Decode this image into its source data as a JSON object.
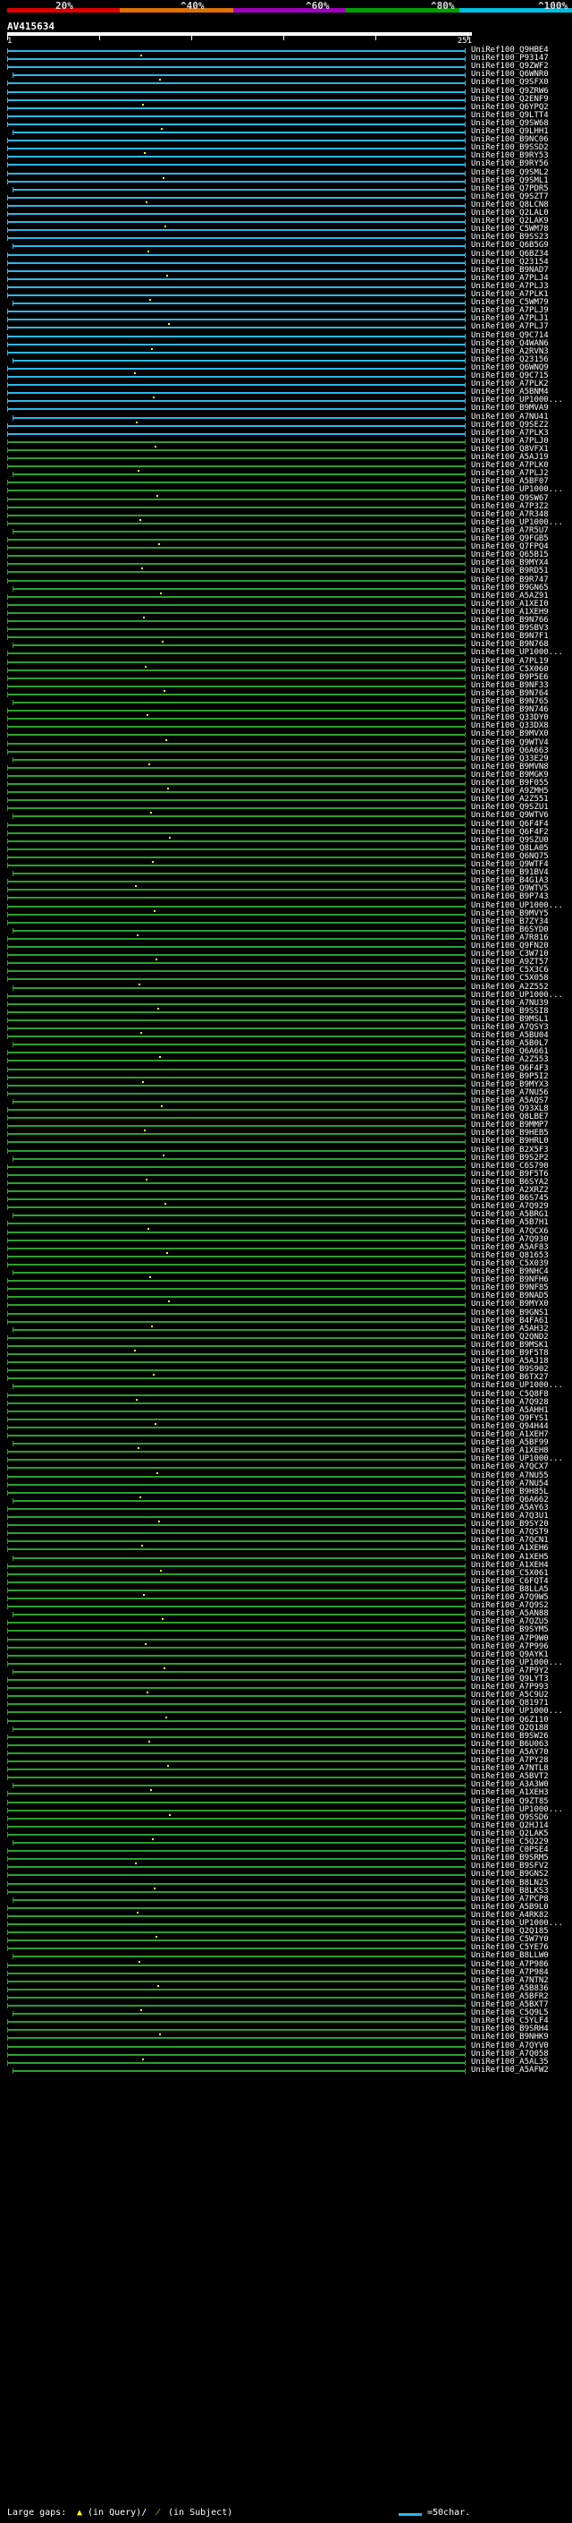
{
  "scale": {
    "labels": [
      "20%",
      "^40%",
      "^60%",
      "^80%",
      "^100%"
    ],
    "colors": [
      "#e00000",
      "#e07000",
      "#a000c0",
      "#00a000",
      "#00c0e0"
    ]
  },
  "query_id": "AV415634",
  "ruler": {
    "start": "1",
    "end": "251"
  },
  "hits": [
    {
      "id": "UniRef100_Q9HBE4",
      "c": "#2bb8e8"
    },
    {
      "id": "UniRef100_P93147",
      "c": "#2bb8e8"
    },
    {
      "id": "UniRef100_Q9ZWF2",
      "c": "#2bb8e8"
    },
    {
      "id": "UniRef100_Q6WNR0",
      "c": "#2bb8e8"
    },
    {
      "id": "UniRef100_Q9SFX0",
      "c": "#2bb8e8"
    },
    {
      "id": "UniRef100_Q9ZRW6",
      "c": "#2bb8e8"
    },
    {
      "id": "UniRef100_Q2ENF9",
      "c": "#2bb8e8"
    },
    {
      "id": "UniRef100_Q6YPQ2",
      "c": "#2bb8e8"
    },
    {
      "id": "UniRef100_Q9LTT4",
      "c": "#2bb8e8"
    },
    {
      "id": "UniRef100_Q9SW68",
      "c": "#2bb8e8"
    },
    {
      "id": "UniRef100_Q9LHH1",
      "c": "#2bb8e8"
    },
    {
      "id": "UniRef100_B9NC06",
      "c": "#2bb8e8"
    },
    {
      "id": "UniRef100_B9SSD2",
      "c": "#2bb8e8"
    },
    {
      "id": "UniRef100_B9RY53",
      "c": "#2bb8e8"
    },
    {
      "id": "UniRef100_B9RY56",
      "c": "#2bb8e8"
    },
    {
      "id": "UniRef100_Q9SML2",
      "c": "#2bb8e8"
    },
    {
      "id": "UniRef100_Q9SML1",
      "c": "#2bb8e8"
    },
    {
      "id": "UniRef100_Q7PDR5",
      "c": "#2bb8e8"
    },
    {
      "id": "UniRef100_Q9SZT7",
      "c": "#2bb8e8"
    },
    {
      "id": "UniRef100_Q8LCN8",
      "c": "#2bb8e8"
    },
    {
      "id": "UniRef100_Q2LAL0",
      "c": "#2bb8e8"
    },
    {
      "id": "UniRef100_Q2LAK9",
      "c": "#2bb8e8"
    },
    {
      "id": "UniRef100_C5WM78",
      "c": "#2bb8e8"
    },
    {
      "id": "UniRef100_B9SS23",
      "c": "#2bb8e8"
    },
    {
      "id": "UniRef100_Q6B5G9",
      "c": "#2bb8e8"
    },
    {
      "id": "UniRef100_Q6BZ34",
      "c": "#2bb8e8"
    },
    {
      "id": "UniRef100_Q23154",
      "c": "#2bb8e8"
    },
    {
      "id": "UniRef100_B9NAD7",
      "c": "#2bb8e8"
    },
    {
      "id": "UniRef100_A7PLJ4",
      "c": "#2bb8e8"
    },
    {
      "id": "UniRef100_A7PLJ3",
      "c": "#2bb8e8"
    },
    {
      "id": "UniRef100_A7PLK1",
      "c": "#2bb8e8"
    },
    {
      "id": "UniRef100_C5WM79",
      "c": "#2bb8e8"
    },
    {
      "id": "UniRef100_A7PLJ9",
      "c": "#2bb8e8"
    },
    {
      "id": "UniRef100_A7PLJ1",
      "c": "#2bb8e8"
    },
    {
      "id": "UniRef100_A7PLJ7",
      "c": "#2bb8e8"
    },
    {
      "id": "UniRef100_Q9C714",
      "c": "#2bb8e8"
    },
    {
      "id": "UniRef100_Q4WAN6",
      "c": "#2bb8e8"
    },
    {
      "id": "UniRef100_A2RVN3",
      "c": "#2bb8e8"
    },
    {
      "id": "UniRef100_Q23156",
      "c": "#2bb8e8"
    },
    {
      "id": "UniRef100_Q6WNQ9",
      "c": "#2bb8e8"
    },
    {
      "id": "UniRef100_Q9C715",
      "c": "#2bb8e8"
    },
    {
      "id": "UniRef100_A7PLK2",
      "c": "#2bb8e8"
    },
    {
      "id": "UniRef100_A5BNM4",
      "c": "#2bb8e8"
    },
    {
      "id": "UniRef100_UP1000...",
      "c": "#2bb8e8"
    },
    {
      "id": "UniRef100_B9MVA9",
      "c": "#2bb8e8"
    },
    {
      "id": "UniRef100_A7NU41",
      "c": "#2bb8e8"
    },
    {
      "id": "UniRef100_Q9SEZ2",
      "c": "#2bb8e8"
    },
    {
      "id": "UniRef100_A7PLK3",
      "c": "#2bb8e8"
    },
    {
      "id": "UniRef100_A7PLJ0",
      "c": "#2bb8e8"
    },
    {
      "id": "UniRef100_Q8VFX1",
      "c": "#2bb8e8"
    },
    {
      "id": "UniRef100_A5AJ19",
      "c": "#2bb8e8"
    },
    {
      "id": "UniRef100_A7PLK0",
      "c": "#2bb8e8"
    },
    {
      "id": "UniRef100_A7PLJ2",
      "c": "#2bb8e8"
    },
    {
      "id": "UniRef100_A5BF07",
      "c": "#2bb8e8"
    },
    {
      "id": "UniRef100_UP1000...",
      "c": "#2bb8e8"
    },
    {
      "id": "UniRef100_Q9SW67",
      "c": "#2bb8e8"
    },
    {
      "id": "UniRef100_A7P3Z2",
      "c": "#2bb8e8"
    },
    {
      "id": "UniRef100_A7R348",
      "c": "#2bb8e8"
    },
    {
      "id": "UniRef100_UP1000...",
      "c": "#2bb8e8"
    },
    {
      "id": "UniRef100_A7R5U7",
      "c": "#2bb8e8"
    },
    {
      "id": "UniRef100_Q9FGB5",
      "c": "#2bb8e8"
    },
    {
      "id": "UniRef100_Q7FPQ4",
      "c": "#2bb8e8"
    },
    {
      "id": "UniRef100_Q65B15",
      "c": "#2bb8e8"
    },
    {
      "id": "UniRef100_B9MYX4",
      "c": "#2bb8e8"
    },
    {
      "id": "UniRef100_B9RD51",
      "c": "#2bb8e8"
    },
    {
      "id": "UniRef100_B9R747",
      "c": "#2bb8e8"
    },
    {
      "id": "UniRef100_B9GN65",
      "c": "#2bb8e8"
    },
    {
      "id": "UniRef100_A5AZ91",
      "c": "#2bb8e8"
    },
    {
      "id": "UniRef100_A1XEI0",
      "c": "#2bb8e8"
    },
    {
      "id": "UniRef100_A1XEH9",
      "c": "#2bb8e8"
    },
    {
      "id": "UniRef100_B9N766",
      "c": "#2bb8e8"
    },
    {
      "id": "UniRef100_B9SBV3",
      "c": "#2bb8e8"
    },
    {
      "id": "UniRef100_B9N7F1",
      "c": "#2bb8e8"
    },
    {
      "id": "UniRef100_B9N768",
      "c": "#2bb8e8"
    },
    {
      "id": "UniRef100_UP1000...",
      "c": "#2bb8e8"
    },
    {
      "id": "UniRef100_A7PL19",
      "c": "#2bb8e8"
    },
    {
      "id": "UniRef100_C5X060",
      "c": "#2bb8e8"
    },
    {
      "id": "UniRef100_B9P5E6",
      "c": "#2bb8e8"
    },
    {
      "id": "UniRef100_B9NF33",
      "c": "#2bb8e8"
    },
    {
      "id": "UniRef100_B9N764",
      "c": "#2bb8e8"
    },
    {
      "id": "UniRef100_B9N765",
      "c": "#2bb8e8"
    },
    {
      "id": "UniRef100_B9N746",
      "c": "#2bb8e8"
    },
    {
      "id": "UniRef100_Q33DY0",
      "c": "#2bb8e8"
    },
    {
      "id": "UniRef100_Q33DX8",
      "c": "#2bb8e8"
    },
    {
      "id": "UniRef100_B9MVX0",
      "c": "#2bb8e8"
    },
    {
      "id": "UniRef100_Q9WTV4",
      "c": "#2bb8e8"
    },
    {
      "id": "UniRef100_Q6A663",
      "c": "#2bb8e8"
    },
    {
      "id": "UniRef100_Q33E29",
      "c": "#2bb8e8"
    },
    {
      "id": "UniRef100_B9MVN8",
      "c": "#2bb8e8"
    },
    {
      "id": "UniRef100_B9MGK9",
      "c": "#2bb8e8"
    },
    {
      "id": "UniRef100_B9F055",
      "c": "#2bb8e8"
    },
    {
      "id": "UniRef100_A9ZMH5",
      "c": "#2bb8e8"
    },
    {
      "id": "UniRef100_A2Z551",
      "c": "#2bb8e8"
    },
    {
      "id": "UniRef100_Q9SZU1",
      "c": "#2bb8e8"
    },
    {
      "id": "UniRef100_Q9WTV6",
      "c": "#2bb8e8"
    },
    {
      "id": "UniRef100_Q6F4F4",
      "c": "#2bb8e8"
    },
    {
      "id": "UniRef100_Q6F4F2",
      "c": "#2bb8e8"
    },
    {
      "id": "UniRef100_Q9SZU0",
      "c": "#2bb8e8"
    },
    {
      "id": "UniRef100_Q8LA05",
      "c": "#2bb8e8"
    },
    {
      "id": "UniRef100_Q6NQ75",
      "c": "#2bb8e8"
    },
    {
      "id": "UniRef100_Q9WTF4",
      "c": "#2bb8e8"
    },
    {
      "id": "UniRef100_B91BV4",
      "c": "#2bb8e8"
    },
    {
      "id": "UniRef100_B4G1A3",
      "c": "#2bb8e8"
    },
    {
      "id": "UniRef100_Q9WTV5",
      "c": "#2bb8e8"
    },
    {
      "id": "UniRef100_B9P743",
      "c": "#2bb8e8"
    },
    {
      "id": "UniRef100_UP1000...",
      "c": "#2bb8e8"
    },
    {
      "id": "UniRef100_B9MVY5",
      "c": "#2bb8e8"
    },
    {
      "id": "UniRef100_B7ZY34",
      "c": "#2bb8e8"
    },
    {
      "id": "UniRef100_B6SYD0",
      "c": "#2bb8e8"
    },
    {
      "id": "UniRef100_A7R816",
      "c": "#2bb8e8"
    },
    {
      "id": "UniRef100_Q9FN20",
      "c": "#2bb8e8"
    },
    {
      "id": "UniRef100_C3W710",
      "c": "#2bb8e8"
    },
    {
      "id": "UniRef100_A9ZT57",
      "c": "#2bb8e8"
    },
    {
      "id": "UniRef100_C5X3C6",
      "c": "#2bb8e8"
    },
    {
      "id": "UniRef100_C5X058",
      "c": "#2bb8e8"
    },
    {
      "id": "UniRef100_A2Z552",
      "c": "#2bb8e8"
    },
    {
      "id": "UniRef100_UP1000...",
      "c": "#2bb8e8"
    },
    {
      "id": "UniRef100_A7NU39",
      "c": "#2bb8e8"
    },
    {
      "id": "UniRef100_B9SSI8",
      "c": "#2bb8e8"
    },
    {
      "id": "UniRef100_B9MSL1",
      "c": "#2bb8e8"
    },
    {
      "id": "UniRef100_A7QSY3",
      "c": "#2bb8e8"
    },
    {
      "id": "UniRef100_A5BU04",
      "c": "#2bb8e8"
    },
    {
      "id": "UniRef100_A5B0L7",
      "c": "#2bb8e8"
    },
    {
      "id": "UniRef100_Q6A661",
      "c": "#2bb8e8"
    },
    {
      "id": "UniRef100_A2Z553",
      "c": "#2bb8e8"
    },
    {
      "id": "UniRef100_Q6F4F3",
      "c": "#2bb8e8"
    },
    {
      "id": "UniRef100_B9P5I2",
      "c": "#2bb8e8"
    },
    {
      "id": "UniRef100_B9MYX3",
      "c": "#2bb8e8"
    },
    {
      "id": "UniRef100_A7NU56",
      "c": "#2bb8e8"
    },
    {
      "id": "UniRef100_A5AQS7",
      "c": "#2bb8e8"
    },
    {
      "id": "UniRef100_Q93XL8",
      "c": "#2bb8e8"
    },
    {
      "id": "UniRef100_Q8LBE7",
      "c": "#2bb8e8"
    },
    {
      "id": "UniRef100_B9MMP7",
      "c": "#2bb8e8"
    },
    {
      "id": "UniRef100_B9HEB5",
      "c": "#2bb8e8"
    },
    {
      "id": "UniRef100_B9HRL0",
      "c": "#2bb8e8"
    },
    {
      "id": "UniRef100_B2X5F3",
      "c": "#2bb8e8"
    },
    {
      "id": "UniRef100_B9S2P2",
      "c": "#2bb8e8"
    },
    {
      "id": "UniRef100_C6S790",
      "c": "#2bb8e8"
    },
    {
      "id": "UniRef100_B9F5T6",
      "c": "#2bb8e8"
    },
    {
      "id": "UniRef100_B6SYA2",
      "c": "#2bb8e8"
    },
    {
      "id": "UniRef100_A2XRZ2",
      "c": "#2bb8e8"
    },
    {
      "id": "UniRef100_B6S745",
      "c": "#2bb8e8"
    },
    {
      "id": "UniRef100_A7Q929",
      "c": "#2bb8e8"
    },
    {
      "id": "UniRef100_A5BRG1",
      "c": "#2bb8e8"
    },
    {
      "id": "UniRef100_A5B7H1",
      "c": "#2bb8e8"
    },
    {
      "id": "UniRef100_A7QCX6",
      "c": "#2bb8e8"
    },
    {
      "id": "UniRef100_A7Q930",
      "c": "#2bb8e8"
    },
    {
      "id": "UniRef100_A5AF83",
      "c": "#2bb8e8"
    },
    {
      "id": "UniRef100_Q81653",
      "c": "#2bb8e8"
    },
    {
      "id": "UniRef100_C5X039",
      "c": "#2bb8e8"
    },
    {
      "id": "UniRef100_B9NHC4",
      "c": "#2bb8e8"
    },
    {
      "id": "UniRef100_B9NFH6",
      "c": "#2bb8e8"
    },
    {
      "id": "UniRef100_B9NF85",
      "c": "#2bb8e8"
    },
    {
      "id": "UniRef100_B9NAD5",
      "c": "#2bb8e8"
    },
    {
      "id": "UniRef100_B9MYX0",
      "c": "#2bb8e8"
    },
    {
      "id": "UniRef100_B9GNS1",
      "c": "#2bb8e8"
    },
    {
      "id": "UniRef100_B4FA61",
      "c": "#2bb8e8"
    },
    {
      "id": "UniRef100_A5AH32",
      "c": "#2bb8e8"
    },
    {
      "id": "UniRef100_Q2QND2",
      "c": "#2bb8e8"
    },
    {
      "id": "UniRef100_B9MSK1",
      "c": "#2bb8e8"
    },
    {
      "id": "UniRef100_B9F5T8",
      "c": "#2bb8e8"
    },
    {
      "id": "UniRef100_A5AJ18",
      "c": "#2bb8e8"
    },
    {
      "id": "UniRef100_B9S902",
      "c": "#2bb8e8"
    },
    {
      "id": "UniRef100_B6TX27",
      "c": "#2bb8e8"
    },
    {
      "id": "UniRef100_UP1000...",
      "c": "#2bb8e8"
    },
    {
      "id": "UniRef100_C5Q8F8",
      "c": "#2bb8e8"
    },
    {
      "id": "UniRef100_A7Q928",
      "c": "#2bb8e8"
    },
    {
      "id": "UniRef100_A5AHH1",
      "c": "#2bb8e8"
    },
    {
      "id": "UniRef100_Q9FYS1",
      "c": "#2bb8e8"
    },
    {
      "id": "UniRef100_Q94H44",
      "c": "#2bb8e8"
    },
    {
      "id": "UniRef100_A1XEH7",
      "c": "#2bb8e8"
    },
    {
      "id": "UniRef100_A5BF99",
      "c": "#2bb8e8"
    },
    {
      "id": "UniRef100_A1XEH8",
      "c": "#2bb8e8"
    },
    {
      "id": "UniRef100_UP1000...",
      "c": "#2bb8e8"
    },
    {
      "id": "UniRef100_A7QCX7",
      "c": "#2bb8e8"
    },
    {
      "id": "UniRef100_A7NU55",
      "c": "#2bb8e8"
    },
    {
      "id": "UniRef100_A7NU54",
      "c": "#2bb8e8"
    },
    {
      "id": "UniRef100_B9H85L",
      "c": "#2bb8e8"
    },
    {
      "id": "UniRef100_Q6A662",
      "c": "#2bb8e8"
    },
    {
      "id": "UniRef100_A5AY63",
      "c": "#2bb8e8"
    },
    {
      "id": "UniRef100_A7Q3U1",
      "c": "#2bb8e8"
    },
    {
      "id": "UniRef100_B9SY20",
      "c": "#2bb8e8"
    },
    {
      "id": "UniRef100_A7QST9",
      "c": "#2bb8e8"
    },
    {
      "id": "UniRef100_A7QCN1",
      "c": "#2bb8e8"
    },
    {
      "id": "UniRef100_A1XEH6",
      "c": "#2bb8e8"
    },
    {
      "id": "UniRef100_A1XEH5",
      "c": "#2bb8e8"
    },
    {
      "id": "UniRef100_A1XEH4",
      "c": "#2bb8e8"
    },
    {
      "id": "UniRef100_C5X061",
      "c": "#2bb8e8"
    },
    {
      "id": "UniRef100_C6FQT4",
      "c": "#2bb8e8"
    },
    {
      "id": "UniRef100_B8LLA5",
      "c": "#2bb8e8"
    },
    {
      "id": "UniRef100_A7Q9W5",
      "c": "#2bb8e8"
    },
    {
      "id": "UniRef100_A7Q9S2",
      "c": "#2bb8e8"
    },
    {
      "id": "UniRef100_A5AN88",
      "c": "#2bb8e8"
    },
    {
      "id": "UniRef100_A7QZU5",
      "c": "#2bb8e8"
    },
    {
      "id": "UniRef100_B9SYM5",
      "c": "#2bb8e8"
    },
    {
      "id": "UniRef100_A7P9W0",
      "c": "#2bb8e8"
    },
    {
      "id": "UniRef100_A7P996",
      "c": "#2bb8e8"
    },
    {
      "id": "UniRef100_Q9AYK1",
      "c": "#2bb8e8"
    },
    {
      "id": "UniRef100_UP1000...",
      "c": "#2bb8e8"
    },
    {
      "id": "UniRef100_A7P9Y2",
      "c": "#2bb8e8"
    },
    {
      "id": "UniRef100_Q9LYT3",
      "c": "#2bb8e8"
    },
    {
      "id": "UniRef100_A7P993",
      "c": "#2bb8e8"
    },
    {
      "id": "UniRef100_A5C9U2",
      "c": "#2bb8e8"
    },
    {
      "id": "UniRef100_Q81971",
      "c": "#2bb8e8"
    },
    {
      "id": "UniRef100_UP1000...",
      "c": "#2bb8e8"
    },
    {
      "id": "UniRef100_Q6Z110",
      "c": "#2bb8e8"
    },
    {
      "id": "UniRef100_Q2Q188",
      "c": "#2bb8e8"
    },
    {
      "id": "UniRef100_B9SW26",
      "c": "#2bb8e8"
    },
    {
      "id": "UniRef100_B6U063",
      "c": "#2bb8e8"
    },
    {
      "id": "UniRef100_A5AY70",
      "c": "#2bb8e8"
    },
    {
      "id": "UniRef100_A7PY28",
      "c": "#2bb8e8"
    },
    {
      "id": "UniRef100_A7NTL8",
      "c": "#2bb8e8"
    },
    {
      "id": "UniRef100_A5BVT2",
      "c": "#2bb8e8"
    },
    {
      "id": "UniRef100_A3A3W0",
      "c": "#2bb8e8"
    },
    {
      "id": "UniRef100_A1XEH3",
      "c": "#2bb8e8"
    },
    {
      "id": "UniRef100_Q9ZT85",
      "c": "#2bb8e8"
    },
    {
      "id": "UniRef100_UP1000...",
      "c": "#2bb8e8"
    },
    {
      "id": "UniRef100_Q9SSD6",
      "c": "#2bb8e8"
    },
    {
      "id": "UniRef100_Q2HJ14",
      "c": "#2bb8e8"
    },
    {
      "id": "UniRef100_Q2LAK5",
      "c": "#2bb8e8"
    },
    {
      "id": "UniRef100_C5Q229",
      "c": "#2bb8e8"
    },
    {
      "id": "UniRef100_C0PSE4",
      "c": "#2bb8e8"
    },
    {
      "id": "UniRef100_B9SRM5",
      "c": "#2bb8e8"
    },
    {
      "id": "UniRef100_B9SFV2",
      "c": "#2bb8e8"
    },
    {
      "id": "UniRef100_B9GNS2",
      "c": "#2bb8e8"
    },
    {
      "id": "UniRef100_B8LN25",
      "c": "#2bb8e8"
    },
    {
      "id": "UniRef100_B8LKS3",
      "c": "#2bb8e8"
    },
    {
      "id": "UniRef100_A7PCP8",
      "c": "#2bb8e8"
    },
    {
      "id": "UniRef100_A5B9L0",
      "c": "#2bb8e8"
    },
    {
      "id": "UniRef100_A4RK82",
      "c": "#2bb8e8"
    },
    {
      "id": "UniRef100_UP1000...",
      "c": "#2bb8e8"
    },
    {
      "id": "UniRef100_Q2Q185",
      "c": "#2bb8e8"
    },
    {
      "id": "UniRef100_C5W7Y0",
      "c": "#2bb8e8"
    },
    {
      "id": "UniRef100_C5YE76",
      "c": "#2bb8e8"
    },
    {
      "id": "UniRef100_B8LLW0",
      "c": "#2bb8e8"
    },
    {
      "id": "UniRef100_A7P986",
      "c": "#2bb8e8"
    },
    {
      "id": "UniRef100_A7P984",
      "c": "#2bb8e8"
    },
    {
      "id": "UniRef100_A7NTN2",
      "c": "#2bb8e8"
    },
    {
      "id": "UniRef100_A5B836",
      "c": "#2bb8e8"
    },
    {
      "id": "UniRef100_A5BFR2",
      "c": "#2bb8e8"
    },
    {
      "id": "UniRef100_A5BXT7",
      "c": "#2bb8e8"
    },
    {
      "id": "UniRef100_C5Q9L5",
      "c": "#2bb8e8"
    },
    {
      "id": "UniRef100_C5YLF4",
      "c": "#2bb8e8"
    },
    {
      "id": "UniRef100_B9SRH4",
      "c": "#2bb8e8"
    },
    {
      "id": "UniRef100_B9NHK9",
      "c": "#2bb8e8"
    },
    {
      "id": "UniRef100_A7QYV0",
      "c": "#2bb8e8"
    },
    {
      "id": "UniRef100_A7Q058",
      "c": "#2bb8e8"
    },
    {
      "id": "UniRef100_A5AL35",
      "c": "#2bb8e8"
    },
    {
      "id": "UniRef100_A5AFW2",
      "c": "#2bb8e8"
    }
  ],
  "legend": {
    "gaps_label": "Large gaps:",
    "query_gap": "(in Query)/",
    "subject_gap": "(in Subject)",
    "scale_note": "=50char."
  }
}
